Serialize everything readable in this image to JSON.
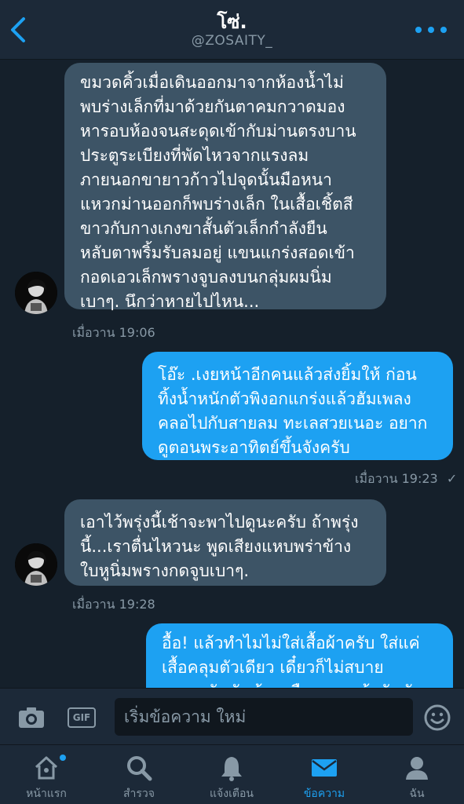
{
  "header": {
    "title": "โซ่.",
    "username": "@ZOSAITY_"
  },
  "messages": [
    {
      "direction": "in",
      "text": "ขมวดคิ้วเมื่อเดินออกมาจากห้องน้ำไม่\nพบร่างเล็กที่มาด้วยกันตาคมกวาดมอง\nหารอบห้องจนสะดุดเข้ากับม่านตรงบาน\nประตูระเบียงที่พัดไหวจากแรงลม\nภายนอกขายาวก้าวไปจุดนั้นมือหนา\nแหวกม่านออกก็พบร่างเล็ก ในเสื้อเชิ้ตสี\nขาวกับกางเกงขาสั้นตัวเล็กกำลังยืน\nหลับตาพริ้มรับลมอยู่ แขนแกร่งสอดเข้า\nกอดเอวเล็กพรางจูบลงบนกลุ่มผมนิ่ม\nเบาๆ. นึกว่าหายไปไหน...",
      "time": "เมื่อวาน 19:06"
    },
    {
      "direction": "out",
      "text": "โอ๊ะ .เงยหน้าอีกคนแล้วส่งยิ้มให้ ก่อน\nทิ้งน้ำหนักตัวพิงอกแกร่งแล้วฮัมเพลง\nคลอไปกับสายลม ทะเลสวยเนอะ อยาก\nดูตอนพระอาทิตย์ขึ้นจังครับ",
      "time": "เมื่อวาน 19:23",
      "read_mark": "✓"
    },
    {
      "direction": "in",
      "text": "เอาไว้พรุ่งนี้เช้าจะพาไปดูนะครับ ถ้าพรุ่ง\nนี้...เราตื่นไหวนะ พูดเสียงแหบพร่าข้าง\nใบหูนิ่มพรางกดจูบเบาๆ.",
      "time": "เมื่อวาน 19:28"
    },
    {
      "direction": "out",
      "text": "อื้อ! แล้วทำไมไม่ใส่เสื้อผ้าครับ ใส่แค่\nเสื้อคลุมตัวเดียว เดี๋ยวก็ไม่สบาย\nหรอก ฉันฉันน้องหรืออยากแล้วฉันฉันขึ้น"
    }
  ],
  "composer": {
    "gif_label": "GIF",
    "placeholder": "เริ่มข้อความ ใหม่"
  },
  "tabs": [
    {
      "label": "หน้าแรก",
      "icon": "home-icon"
    },
    {
      "label": "สำรวจ",
      "icon": "search-icon"
    },
    {
      "label": "แจ้งเตือน",
      "icon": "bell-icon"
    },
    {
      "label": "ข้อความ",
      "icon": "mail-icon",
      "active": true
    },
    {
      "label": "ฉัน",
      "icon": "person-icon"
    }
  ],
  "colors": {
    "accent": "#1da1f2",
    "background": "#15202b",
    "bar": "#1c2938",
    "incoming_bubble": "#3d5466",
    "muted": "#8899a6"
  }
}
